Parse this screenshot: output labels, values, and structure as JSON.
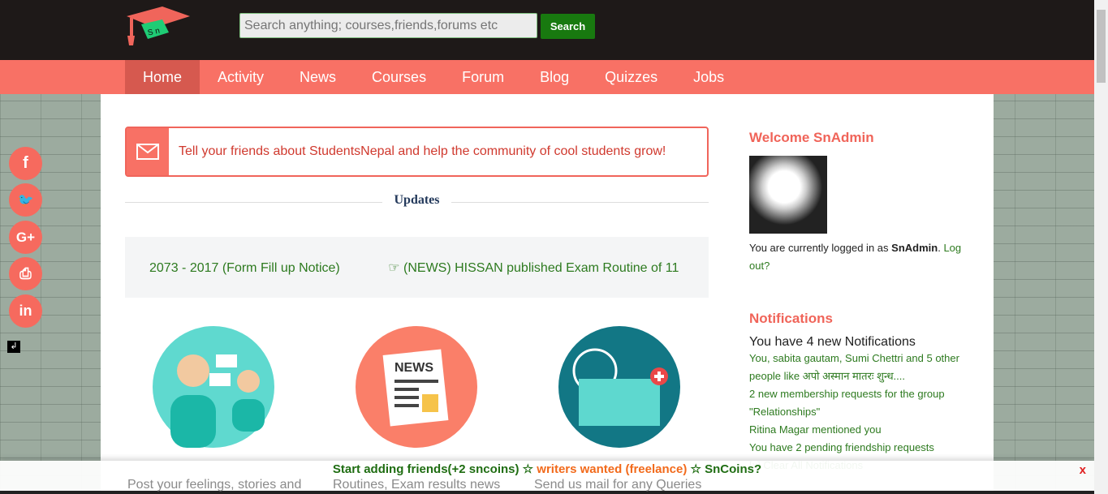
{
  "header": {
    "search_placeholder": "Search anything; courses,friends,forums etc",
    "search_button": "Search",
    "logo_text": "Sn"
  },
  "nav": {
    "items": [
      "Home",
      "Activity",
      "News",
      "Courses",
      "Forum",
      "Blog",
      "Quizzes",
      "Jobs"
    ],
    "active": "Home"
  },
  "invite": {
    "text": "Tell your friends about StudentsNepal and help the community of cool students grow!"
  },
  "updates": {
    "title": "Updates",
    "items": [
      "2073 - 2017 (Form Fill up Notice)",
      "☞ (NEWS) HISSAN published Exam Routine of 11"
    ]
  },
  "features": [
    {
      "caption": "Post your feelings, stories and",
      "icon": "people-chat-icon"
    },
    {
      "caption": "Routines, Exam results news",
      "icon": "news-icon"
    },
    {
      "caption": "Send us mail for any Queries",
      "icon": "mail-icon"
    }
  ],
  "sidebar": {
    "welcome": "Welcome SnAdmin",
    "logged_prefix": "You are currently logged in as",
    "username": "SnAdmin",
    "logout": "Log out?",
    "notifications_title": "Notifications",
    "notifications_count": "You have 4 new Notifications",
    "notifications": [
      "You, sabita gautam, Sumi Chettri and 5 other people like अपो अस्मान मातरः शुन्ध....",
      "2 new membership requests for the group \"Relationships\"",
      "Ritina Magar mentioned you",
      "You have 2 pending friendship requests",
      "[x] Clear All Notifications"
    ]
  },
  "social": [
    "f",
    "t",
    "G+",
    "print",
    "in"
  ],
  "bottom_bar": {
    "part1": "Start adding friends(+2 sncoins)",
    "sep": "☆",
    "part2": "writers wanted (freelance)",
    "part3": "SnCoins?",
    "close": "x"
  },
  "colors": {
    "brand": "#f87165",
    "header": "#1e1918",
    "link": "#2d7a1f",
    "button": "#18790f"
  }
}
